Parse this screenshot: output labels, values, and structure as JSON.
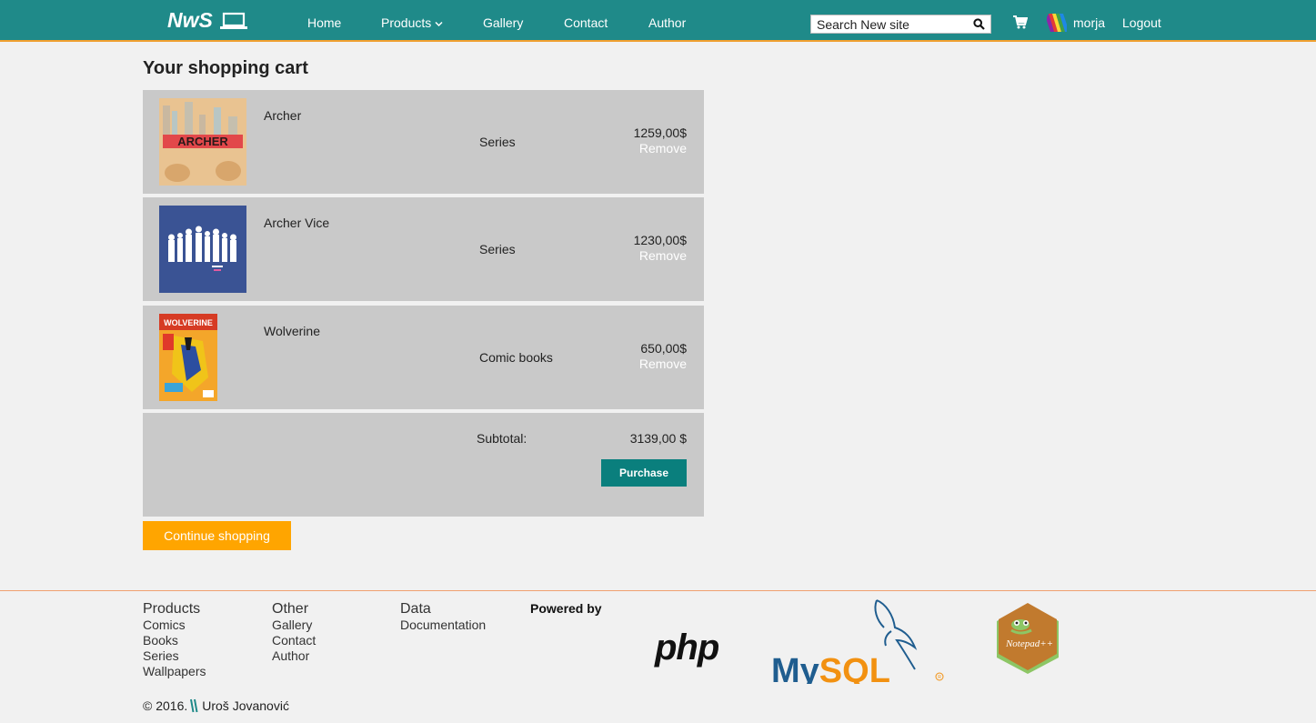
{
  "navbar": {
    "brand": "NwS",
    "links": [
      "Home",
      "Products",
      "Gallery",
      "Contact",
      "Author"
    ],
    "search_placeholder": "Search New site",
    "username": "morja",
    "logout": "Logout"
  },
  "cart": {
    "title": "Your shopping cart",
    "items": [
      {
        "name": "Archer",
        "category": "Series",
        "price": "1259,00$",
        "remove": "Remove",
        "thumb_text": "ARCHER"
      },
      {
        "name": "Archer Vice",
        "category": "Series",
        "price": "1230,00$",
        "remove": "Remove"
      },
      {
        "name": "Wolverine",
        "category": "Comic books",
        "price": "650,00$",
        "remove": "Remove",
        "thumb_text": "WOLVERINE"
      }
    ],
    "subtotal_label": "Subtotal:",
    "subtotal_value": "3139,00 $",
    "purchase": "Purchase",
    "continue": "Continue shopping"
  },
  "footer": {
    "columns": [
      {
        "title": "Products",
        "links": [
          "Comics",
          "Books",
          "Series",
          "Wallpapers"
        ]
      },
      {
        "title": "Other",
        "links": [
          "Gallery",
          "Contact",
          "Author"
        ]
      },
      {
        "title": "Data",
        "links": [
          "Documentation"
        ]
      }
    ],
    "powered_by": "Powered by",
    "logos": {
      "php": "php",
      "mysql": "MySQL",
      "notepad": "Notepad++"
    },
    "copyright": "© 2016.",
    "author": "Uroš Jovanović"
  },
  "colors": {
    "navbar": "#1f8a89",
    "accent": "#ffa500",
    "purchase": "#0a7f7d",
    "row_bg": "#c9c9c9"
  }
}
